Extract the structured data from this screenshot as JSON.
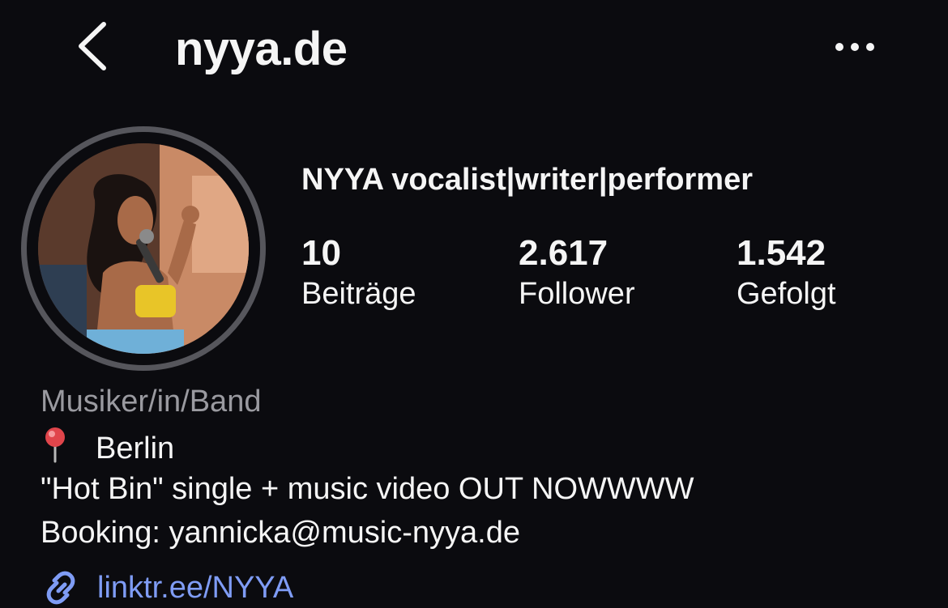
{
  "header": {
    "back_icon": "chevron-left-icon",
    "username": "nyya.de",
    "more_icon": "more-horizontal-icon"
  },
  "profile": {
    "display_name": "NYYA vocalist|writer|performer",
    "stats": [
      {
        "value": "10",
        "label": "Beiträge"
      },
      {
        "value": "2.617",
        "label": "Follower"
      },
      {
        "value": "1.542",
        "label": "Gefolgt"
      }
    ],
    "category": "Musiker/in/Band",
    "bio": {
      "location_icon": "pushpin-icon",
      "location": "Berlin",
      "line2": "\"Hot Bin\" single + music video OUT NOWWWW",
      "line3": "Booking: yannicka@music-nyya.de"
    },
    "link": {
      "icon": "link-icon",
      "text": "linktr.ee/NYYA"
    }
  },
  "colors": {
    "background": "#0b0b0f",
    "text": "#f5f5f5",
    "muted": "#9a9aa0",
    "link": "#7f9cf5",
    "avatar_ring": "#56565c"
  }
}
